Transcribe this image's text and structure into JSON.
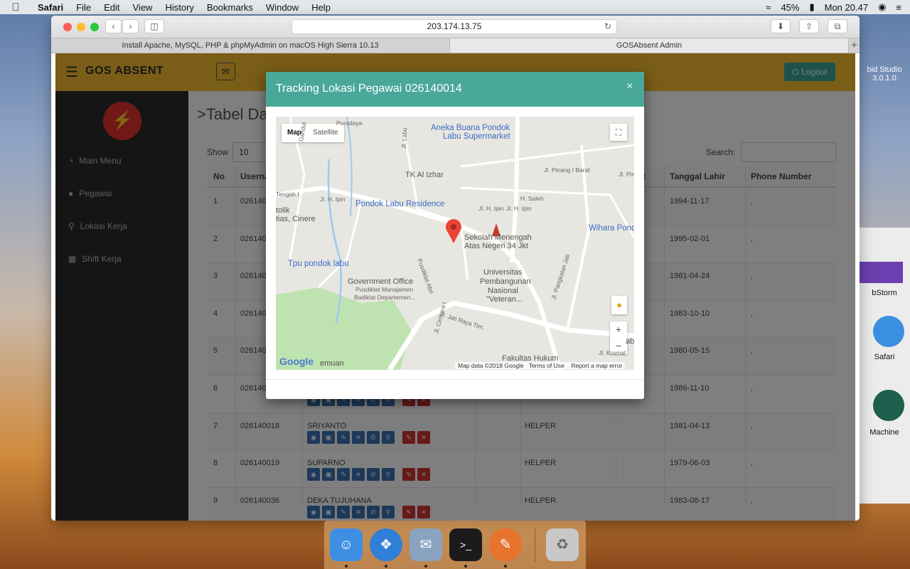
{
  "menubar": {
    "app": "Safari",
    "items": [
      "File",
      "Edit",
      "View",
      "History",
      "Bookmarks",
      "Window",
      "Help"
    ],
    "battery": "45%",
    "clock": "Mon 20.47"
  },
  "desktop": {
    "apps": [
      "bid Studio",
      "3.0.1.0",
      "bStorm",
      "Safari",
      "Machine"
    ]
  },
  "browser": {
    "url": "203.174.13.75",
    "tabs": [
      "Install Apache, MySQL, PHP & phpMyAdmin on macOS High Sierra 10.13",
      "GOSAbsent Admin"
    ]
  },
  "app": {
    "brand": "GOS ABSENT",
    "logout": "Logout",
    "sidebar": [
      "Main Menu",
      "Pegawai",
      "Lokasi Kerja",
      "Shift Kerja"
    ],
    "page_title": ">Tabel Dat",
    "show_label": "Show",
    "show_value": "10",
    "search_label": "Search:",
    "columns": [
      "No",
      "Userna",
      "t",
      "Tanggal Lahir",
      "Phone Number"
    ],
    "rows": [
      {
        "no": "1",
        "user": "026140",
        "name": "",
        "jab": "",
        "dob": "1994-11-17",
        "phone": ","
      },
      {
        "no": "2",
        "user": "026140",
        "name": "",
        "jab": "",
        "dob": "1995-02-01",
        "phone": ","
      },
      {
        "no": "3",
        "user": "026140",
        "name": "",
        "jab": "",
        "dob": "1981-04-24",
        "phone": ","
      },
      {
        "no": "4",
        "user": "026140",
        "name": "",
        "jab": "",
        "dob": "1983-10-10",
        "phone": ","
      },
      {
        "no": "5",
        "user": "026140",
        "name": "",
        "jab": "",
        "dob": "1980-05-15",
        "phone": ","
      },
      {
        "no": "6",
        "user": "026140",
        "name": "",
        "jab": "",
        "dob": "1986-11-10",
        "phone": ","
      },
      {
        "no": "7",
        "user": "026140018",
        "name": "SRIYANTO",
        "jab": "HELPER",
        "dob": "1981-04-13",
        "phone": ","
      },
      {
        "no": "8",
        "user": "026140019",
        "name": "SUPARNO",
        "jab": "HELPER",
        "dob": "1979-06-03",
        "phone": ","
      },
      {
        "no": "9",
        "user": "026140036",
        "name": "DEKA TUJUHANA",
        "jab": "HELPER",
        "dob": "1983-08-17",
        "phone": ","
      }
    ]
  },
  "modal": {
    "title": "Tracking Lokasi Pegawai 026140014",
    "close": "×",
    "map": {
      "type_map": "Map",
      "type_satellite": "Satellite",
      "labels": [
        "Aneka Buana Pondok",
        "Labu Supermarket",
        "TK Al Izhar",
        "Jl. Pinang I Barat",
        "Jl. Pinan",
        "Pondok Labu Residence",
        "H. Saleh",
        "Jl. H. Ipin",
        "Wihara Pond",
        "tolik",
        "tias, Cinere",
        "Sekolah Menengah",
        "Atas Negeri 34 Jkt",
        "Tpu pondok labu",
        "Government Office",
        "Pusdiklat Manajemen",
        "Badiklat Departemen...",
        "Universitas",
        "Pembangunan",
        "Nasional",
        "\"Veteran...",
        "Jl. Jati Raya Tim.",
        "Jl. Pangkalan Jati",
        "Fakultas Hukum",
        "Jl. Kramat",
        "Tengah I",
        "Jl. H. Ipin",
        "Gandul",
        "Puradaya",
        "Jl. Labu",
        "Pusdiklat Abri",
        "Jl. Cemara I",
        "emuan",
        "Jl. H. Ipin",
        "ab"
      ],
      "attribution": "Map data ©2018 Google",
      "terms": "Terms of Use",
      "report": "Report a map error",
      "google": "Google"
    }
  },
  "colors": {
    "header": "#f4bc2e",
    "modal_header": "#4aa89b",
    "logout": "#3aa698",
    "sidebar": "#2b2b2b",
    "logo": "#e0322d"
  }
}
